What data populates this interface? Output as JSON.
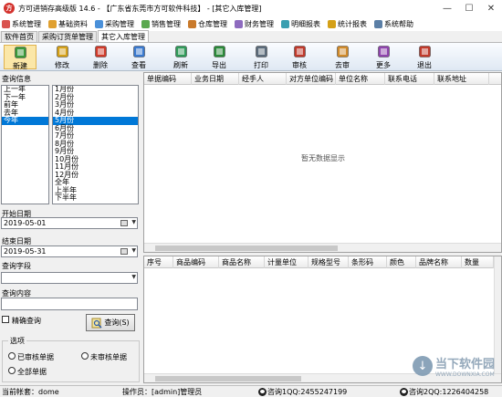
{
  "window": {
    "title": "方可进销存高级版 14.6 - 【广东省东莞市方可软件科技】 - [其它入库管理]",
    "logo_text": "方",
    "min": "—",
    "max": "☐",
    "close": "✕"
  },
  "menu": [
    {
      "label": "系统管理",
      "color": "#d9534f"
    },
    {
      "label": "基础资料",
      "color": "#e0a030"
    },
    {
      "label": "采购管理",
      "color": "#4a90d9"
    },
    {
      "label": "销售管理",
      "color": "#5aa84f"
    },
    {
      "label": "仓库管理",
      "color": "#c97a2b"
    },
    {
      "label": "财务管理",
      "color": "#8e6bbf"
    },
    {
      "label": "明细报表",
      "color": "#3a9fb0"
    },
    {
      "label": "统计报表",
      "color": "#d4a017"
    },
    {
      "label": "系统帮助",
      "color": "#5b7fa6"
    }
  ],
  "tabs": [
    "软件首页",
    "采购订货单管理",
    "其它入库管理"
  ],
  "toolbar": [
    {
      "label": "新建",
      "icon": "new-icon",
      "color": "#3a9a3a"
    },
    {
      "label": "修改",
      "icon": "edit-icon",
      "color": "#d4a017"
    },
    {
      "label": "删除",
      "icon": "delete-icon",
      "color": "#d03a2a"
    },
    {
      "label": "查看",
      "icon": "view-icon",
      "color": "#3a7ad0"
    },
    {
      "label": "刷新",
      "icon": "refresh-icon",
      "color": "#2f9a5a"
    },
    {
      "label": "导出",
      "icon": "export-icon",
      "color": "#2a8a3a"
    },
    {
      "label": "打印",
      "icon": "print-icon",
      "color": "#5a6a7a"
    },
    {
      "label": "审核",
      "icon": "approve-icon",
      "color": "#c0392b"
    },
    {
      "label": "去审",
      "icon": "unapprove-icon",
      "color": "#d08a2a"
    },
    {
      "label": "更多",
      "icon": "more-icon",
      "color": "#8e44ad"
    },
    {
      "label": "退出",
      "icon": "exit-icon",
      "color": "#c0392b"
    }
  ],
  "query": {
    "info_label": "查询信息",
    "periods": [
      "上一年",
      "下一年",
      "前年",
      "去年",
      "今年"
    ],
    "selected_period": 4,
    "months": [
      "1月份",
      "2月份",
      "3月份",
      "4月份",
      "5月份",
      "6月份",
      "7月份",
      "8月份",
      "9月份",
      "10月份",
      "11月份",
      "12月份",
      "全年",
      "上半年",
      "下半年"
    ],
    "selected_month": 4,
    "start_label": "开始日期",
    "start_date": "2019-05-01",
    "end_label": "结束日期",
    "end_date": "2019-05-31",
    "mode_label": "查询字段",
    "mode_value": "",
    "content_label": "查询内容",
    "content_value": "",
    "exact_label": "精确查询",
    "exact_checked": false,
    "button_label": "查询(S)"
  },
  "options": {
    "label": "选项",
    "approved": "已审核单据",
    "unapproved": "未审核单据",
    "all": "全部单据"
  },
  "top_grid": {
    "columns": [
      "单据编码",
      "业务日期",
      "经手人",
      "对方单位编码",
      "单位名称",
      "联系电话",
      "联系地址"
    ],
    "empty_text": "暂无数据显示"
  },
  "bottom_grid": {
    "columns": [
      "序号",
      "商品编码",
      "商品名称",
      "计量单位",
      "规格型号",
      "条形码",
      "颜色",
      "品牌名称",
      "数量"
    ]
  },
  "status": {
    "account": "当前帐套：dome",
    "operator": "操作员：[admin]管理员",
    "qq1": "咨询1QQ:2455247199",
    "qq2": "咨询2QQ:1226404258"
  },
  "watermark": {
    "title": "当下软件园",
    "url": "WWW.DOWNXIA.COM"
  }
}
